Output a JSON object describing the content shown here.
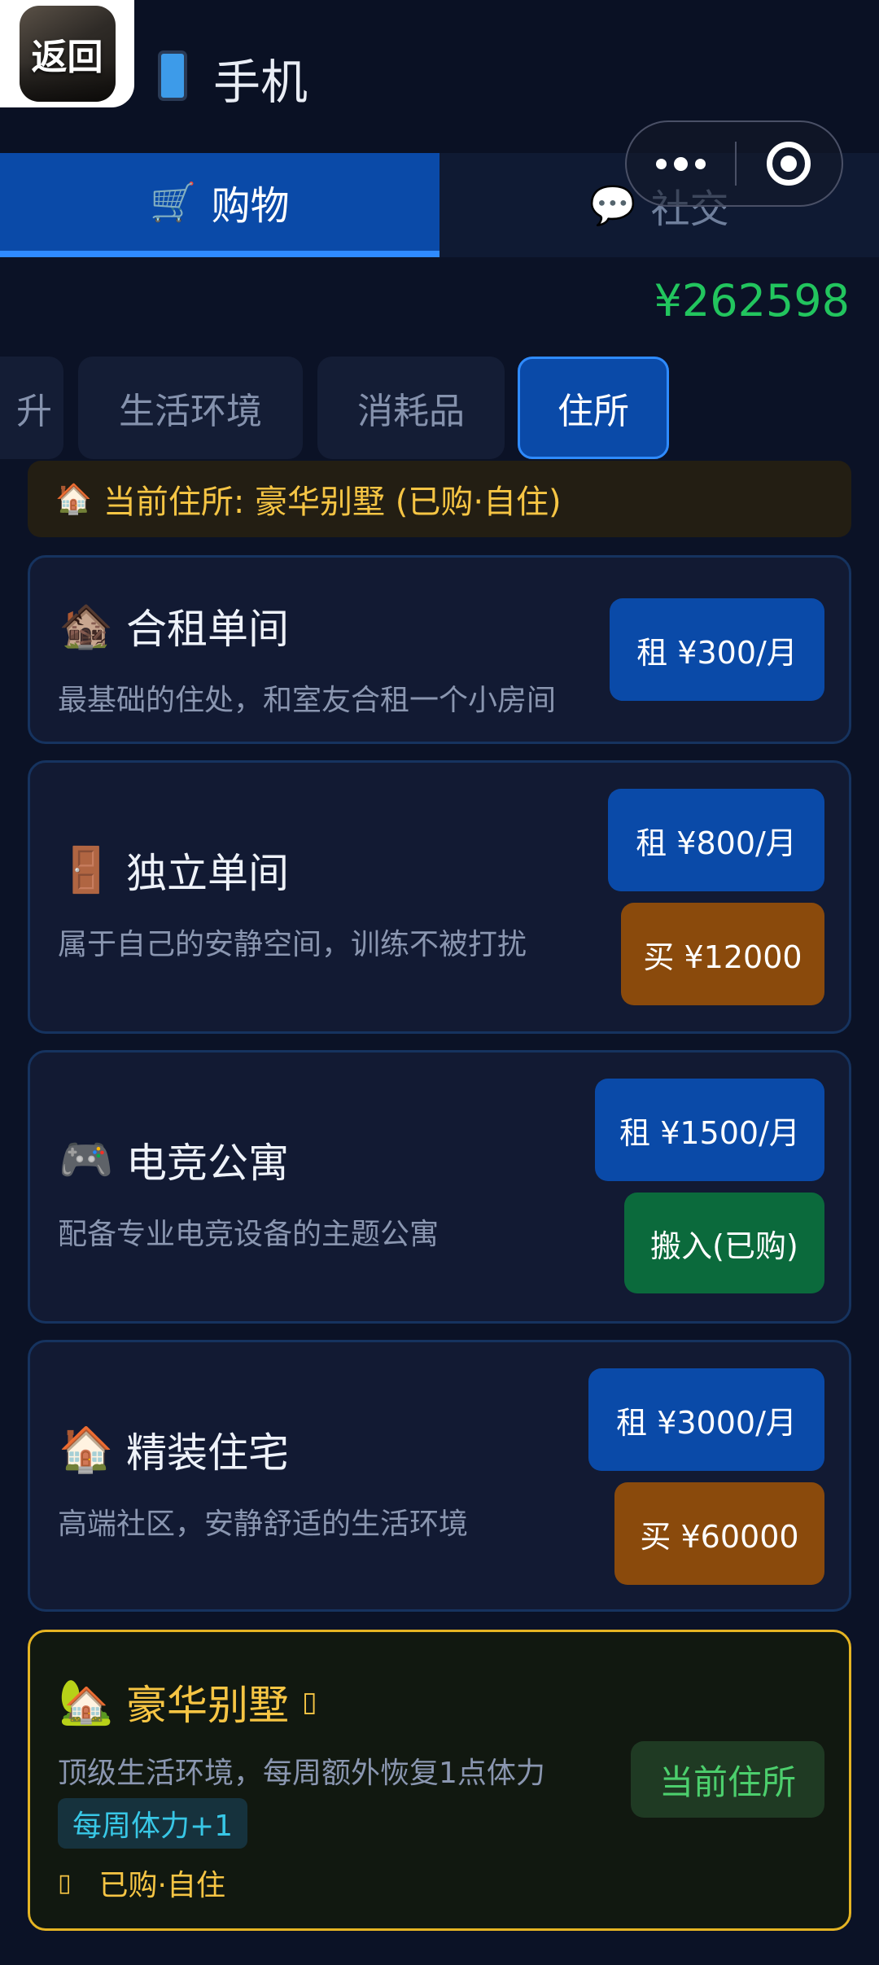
{
  "header": {
    "back_label": "返回",
    "title": "手机",
    "phone_icon": "mobile-phone-icon"
  },
  "main_tabs": [
    {
      "icon": "🛒",
      "label": "购物",
      "active": true
    },
    {
      "icon": "💬",
      "label": "社交",
      "active": false
    }
  ],
  "balance": "¥262598",
  "sub_tabs": [
    {
      "label": "升",
      "active": false
    },
    {
      "label": "生活环境",
      "active": false
    },
    {
      "label": "消耗品",
      "active": false
    },
    {
      "label": "住所",
      "active": true
    }
  ],
  "current_residence": {
    "icon": "🏠",
    "text": "当前住所: 豪华别墅 (已购·自住)"
  },
  "residences": [
    {
      "icon": "🏚️",
      "name": "合租单间",
      "desc": "最基础的住处，和室友合租一个小房间",
      "rent_label": "租 ¥300/月"
    },
    {
      "icon": "🚪",
      "name": "独立单间",
      "desc": "属于自己的安静空间，训练不被打扰",
      "rent_label": "租 ¥800/月",
      "buy_label": "买 ¥12000"
    },
    {
      "icon": "🎮",
      "name": "电竞公寓",
      "desc": "配备专业电竞设备的主题公寓",
      "rent_label": "租 ¥1500/月",
      "owned_label": "搬入(已购)"
    },
    {
      "icon": "🏠",
      "name": "精装住宅",
      "desc": "高端社区，安静舒适的生活环境",
      "rent_label": "租 ¥3000/月",
      "buy_label": "买 ¥60000"
    },
    {
      "icon": "🏡",
      "name": "豪华别墅",
      "title_icon": "▯",
      "desc": "顶级生活环境，每周额外恢复1点体力",
      "bonus": "每周体力+1",
      "owned_icon": "▯",
      "owned_note": "已购·自住",
      "current_label": "当前住所"
    }
  ],
  "colors": {
    "accent_blue": "#0a4aa8",
    "balance_green": "#22c55e",
    "gold": "#f6c544",
    "buy_brown": "#8a4a0c",
    "owned_green": "#0b6a3c"
  }
}
